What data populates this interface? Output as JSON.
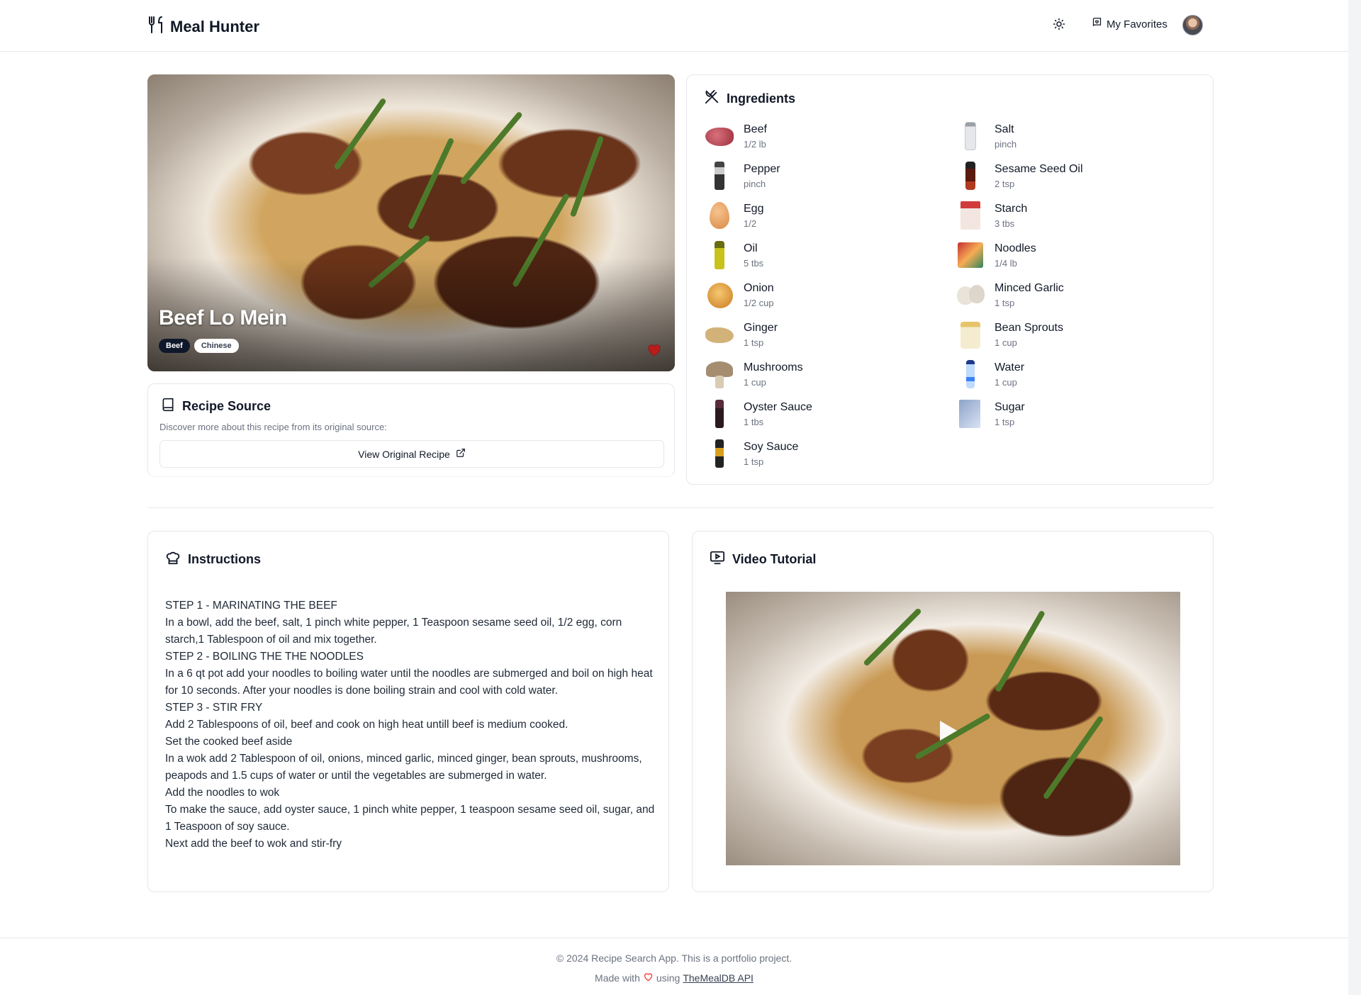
{
  "header": {
    "brand_title": "Meal Hunter",
    "favorites_label": "My Favorites"
  },
  "hero": {
    "title": "Beef Lo Mein",
    "tags": [
      "Beef",
      "Chinese"
    ],
    "favorite": true
  },
  "source": {
    "title": "Recipe Source",
    "description": "Discover more about this recipe from its original source:",
    "button_label": "View Original Recipe"
  },
  "ingredients": {
    "title": "Ingredients",
    "column1": [
      {
        "name": "Beef",
        "qty": "1/2 lb",
        "icon": "beef-icon"
      },
      {
        "name": "Pepper",
        "qty": "pinch",
        "icon": "pepper-icon"
      },
      {
        "name": "Egg",
        "qty": "1/2",
        "icon": "egg-icon"
      },
      {
        "name": "Oil",
        "qty": "5 tbs",
        "icon": "oil-icon"
      },
      {
        "name": "Onion",
        "qty": "1/2 cup",
        "icon": "onion-icon"
      },
      {
        "name": "Ginger",
        "qty": "1 tsp",
        "icon": "ginger-icon"
      },
      {
        "name": "Mushrooms",
        "qty": "1 cup",
        "icon": "mushroom-icon"
      },
      {
        "name": "Oyster Sauce",
        "qty": "1 tbs",
        "icon": "oyster-sauce-icon"
      },
      {
        "name": "Soy Sauce",
        "qty": "1 tsp",
        "icon": "soy-sauce-icon"
      }
    ],
    "column2": [
      {
        "name": "Salt",
        "qty": "pinch",
        "icon": "salt-icon"
      },
      {
        "name": "Sesame Seed Oil",
        "qty": "2 tsp",
        "icon": "sesame-oil-icon"
      },
      {
        "name": "Starch",
        "qty": "3 tbs",
        "icon": "starch-icon"
      },
      {
        "name": "Noodles",
        "qty": "1/4 lb",
        "icon": "noodles-icon"
      },
      {
        "name": "Minced Garlic",
        "qty": "1 tsp",
        "icon": "garlic-icon"
      },
      {
        "name": "Bean Sprouts",
        "qty": "1 cup",
        "icon": "bean-sprouts-icon"
      },
      {
        "name": "Water",
        "qty": "1 cup",
        "icon": "water-icon"
      },
      {
        "name": "Sugar",
        "qty": "1 tsp",
        "icon": "sugar-icon"
      }
    ]
  },
  "instructions": {
    "title": "Instructions",
    "lines": [
      "STEP 1 - MARINATING THE BEEF",
      "In a bowl, add the beef, salt, 1 pinch white pepper, 1 Teaspoon sesame seed oil, 1/2 egg, corn starch,1 Tablespoon of oil and mix together.",
      "STEP 2 - BOILING THE THE NOODLES",
      "In a 6 qt pot add your noodles to boiling water until the noodles are submerged and boil on high heat for 10 seconds. After your noodles is done boiling strain and cool with cold water.",
      "STEP 3 - STIR FRY",
      "Add 2 Tablespoons of oil, beef and cook on high heat untill beef is medium cooked.",
      "Set the cooked beef aside",
      "In a wok add 2 Tablespoon of oil, onions, minced garlic, minced ginger, bean sprouts, mushrooms, peapods and 1.5 cups of water or until the vegetables are submerged in water.",
      "Add the noodles to wok",
      "To make the sauce, add oyster sauce, 1 pinch white pepper, 1 teaspoon sesame seed oil, sugar, and 1 Teaspoon of soy sauce.",
      "Next add the beef to wok and stir-fry"
    ]
  },
  "video": {
    "title": "Video Tutorial"
  },
  "footer": {
    "line1": "© 2024 Recipe Search App. This is a portfolio project.",
    "made_with": "Made with",
    "using": "using",
    "api_link": "TheMealDB API"
  },
  "colors": {
    "accent": "#0f172a",
    "heart": "#b91c1c",
    "footer_heart": "#ef4444",
    "muted": "#6b7280",
    "border": "#e5e7eb"
  }
}
